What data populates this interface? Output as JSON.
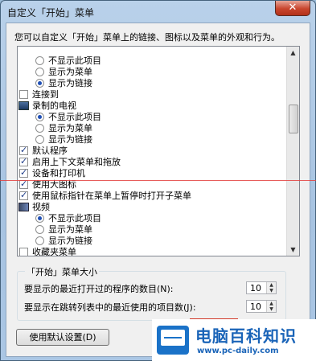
{
  "window": {
    "title": "自定义「开始」菜单",
    "close_glyph": "✕"
  },
  "description": "您可以自定义「开始」菜单上的链接、图标以及菜单的外观和行为。",
  "list_items": [
    {
      "type": "radio",
      "label": "不显示此项目",
      "checked": false
    },
    {
      "type": "radio",
      "label": "显示为菜单",
      "checked": false
    },
    {
      "type": "radio",
      "label": "显示为链接",
      "checked": true
    },
    {
      "type": "checkbox",
      "label": "连接到",
      "checked": false
    },
    {
      "type": "header",
      "icon": "tv-icon",
      "label": "录制的电视"
    },
    {
      "type": "radio",
      "label": "不显示此项目",
      "checked": true
    },
    {
      "type": "radio",
      "label": "显示为菜单",
      "checked": false
    },
    {
      "type": "radio",
      "label": "显示为链接",
      "checked": false
    },
    {
      "type": "checkbox",
      "label": "默认程序",
      "checked": true
    },
    {
      "type": "checkbox",
      "label": "启用上下文菜单和拖放",
      "checked": true
    },
    {
      "type": "checkbox",
      "label": "设备和打印机",
      "checked": true
    },
    {
      "type": "checkbox",
      "label": "使用大图标",
      "checked": true
    },
    {
      "type": "checkbox",
      "label": "使用鼠标指针在菜单上暂停时打开子菜单",
      "checked": true
    },
    {
      "type": "header",
      "icon": "video-icon",
      "label": "视频"
    },
    {
      "type": "radio",
      "label": "不显示此项目",
      "checked": true
    },
    {
      "type": "radio",
      "label": "显示为菜单",
      "checked": false
    },
    {
      "type": "radio",
      "label": "显示为链接",
      "checked": false
    },
    {
      "type": "checkbox",
      "label": "收藏夹菜单",
      "checked": false
    }
  ],
  "size_group": {
    "title": "「开始」菜单大小",
    "recent_programs_label": "要显示的最近打开过的程序的数目(N):",
    "recent_programs_value": "10",
    "recent_items_label": "要显示在跳转列表中的最近使用的项目数(J):",
    "recent_items_value": "10"
  },
  "buttons": {
    "defaults": "使用默认设置(D)"
  },
  "watermark": {
    "title": "电脑百科知识",
    "url": "www.pc-daily.com"
  }
}
